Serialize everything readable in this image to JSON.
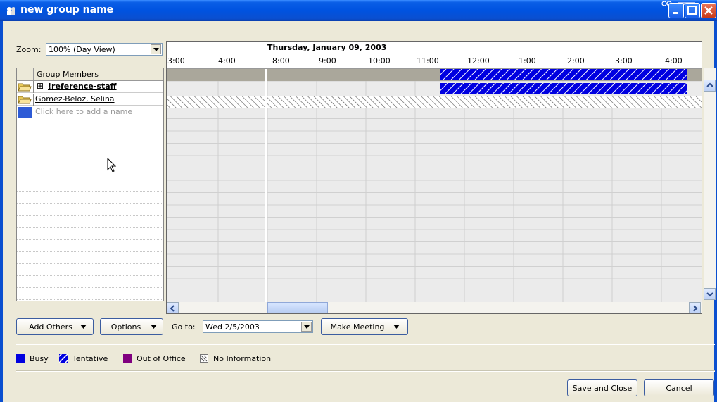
{
  "window": {
    "title": "new group name"
  },
  "zoom": {
    "label": "Zoom:",
    "value": "100% (Day View)"
  },
  "members": {
    "header": "Group Members",
    "rows": [
      {
        "name": "!reference-staff",
        "expand": "⊞"
      },
      {
        "name": "Gomez-Beloz, Selina"
      }
    ],
    "add_placeholder": "Click here to add a name"
  },
  "schedule": {
    "date": "Thursday, January 09, 2003",
    "times": [
      "3:00",
      "4:00",
      "8:00",
      "9:00",
      "10:00",
      "11:00",
      "12:00",
      "1:00",
      "2:00",
      "3:00",
      "4:00"
    ]
  },
  "controls": {
    "add_others": "Add Others",
    "options": "Options",
    "goto_label": "Go to:",
    "goto_value": "Wed 2/5/2003",
    "make_meeting": "Make Meeting"
  },
  "legend": {
    "busy": "Busy",
    "tentative": "Tentative",
    "out_of_office": "Out of Office",
    "no_information": "No Information"
  },
  "footer": {
    "save": "Save and Close",
    "cancel": "Cancel"
  },
  "colors": {
    "busy": "#0000e0",
    "tentative": "#0000e0",
    "out_of_office": "#800080",
    "title_bar": "#0053e0"
  }
}
